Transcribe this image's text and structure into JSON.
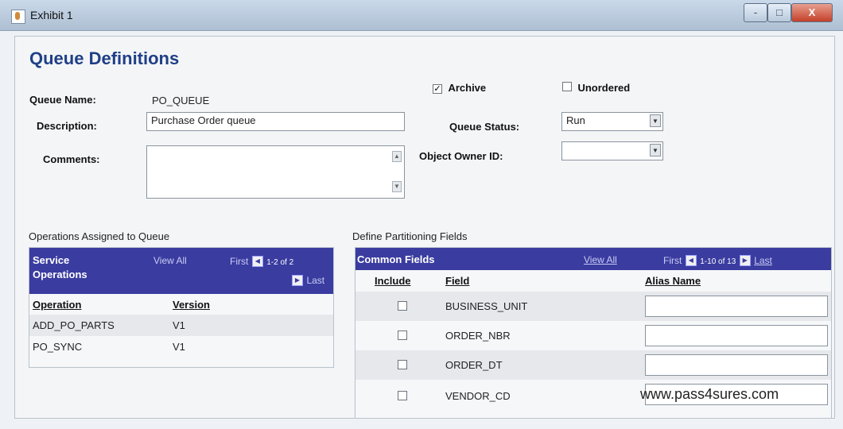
{
  "window": {
    "title": "Exhibit 1",
    "controls": [
      "-",
      "□",
      "X"
    ]
  },
  "page": {
    "heading": "Queue Definitions",
    "queue_name_label": "Queue Name:",
    "queue_name_value": "PO_QUEUE",
    "description_label": "Description:",
    "description_value": "Purchase Order queue",
    "comments_label": "Comments:",
    "comments_value": "",
    "archive_label": "Archive",
    "archive_checked": true,
    "unordered_label": "Unordered",
    "unordered_checked": false,
    "queue_status_label": "Queue Status:",
    "queue_status_value": "Run",
    "object_owner_label": "Object Owner ID:",
    "object_owner_value": ""
  },
  "operations": {
    "section_title": "Operations Assigned to Queue",
    "header_title_line1": "Service",
    "header_title_line2": "Operations",
    "view_all": "View All",
    "first": "First",
    "range": "1-2 of 2",
    "last": "Last",
    "col_operation": "Operation",
    "col_version": "Version",
    "rows": [
      {
        "operation": "ADD_PO_PARTS",
        "version": "V1"
      },
      {
        "operation": "PO_SYNC",
        "version": "V1"
      }
    ]
  },
  "partition": {
    "section_title": "Define Partitioning Fields",
    "header_title": "Common Fields",
    "view_all": "View All",
    "first": "First",
    "range": "1-10 of 13",
    "last": "Last",
    "col_include": "Include",
    "col_field": "Field",
    "col_alias": "Alias Name",
    "rows": [
      {
        "include": false,
        "field": "BUSINESS_UNIT",
        "alias": ""
      },
      {
        "include": false,
        "field": "ORDER_NBR",
        "alias": ""
      },
      {
        "include": false,
        "field": "ORDER_DT",
        "alias": ""
      },
      {
        "include": false,
        "field": "VENDOR_CD",
        "alias": ""
      }
    ]
  },
  "watermark": "www.pass4sures.com"
}
